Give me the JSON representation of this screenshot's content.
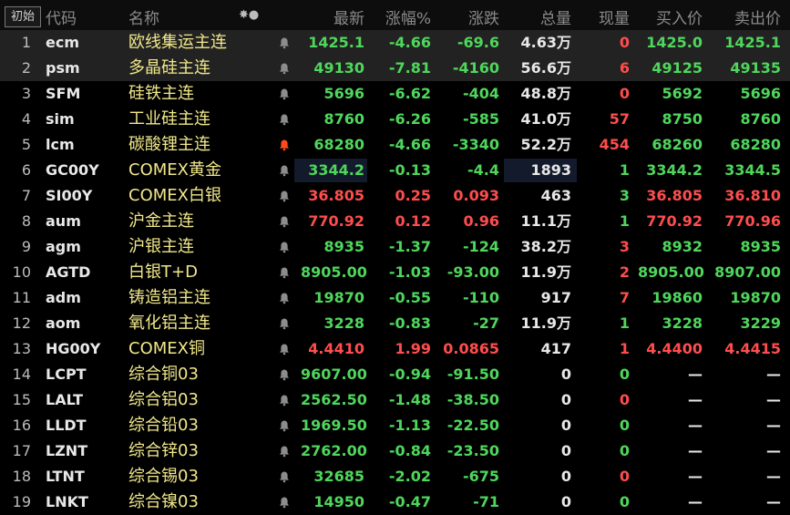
{
  "header": {
    "init_button": "初始",
    "columns": [
      "代码",
      "名称",
      "最新",
      "涨幅%",
      "涨跌",
      "总量",
      "现量",
      "买入价",
      "卖出价"
    ],
    "col_icons": "✸●"
  },
  "colors": {
    "up": "#ff4d4d",
    "down": "#4fd65c",
    "neutral": "#e8e8e8",
    "name": "#f0e78a"
  },
  "rows": [
    {
      "idx": "1",
      "code": "ecm",
      "name": "欧线集运主连",
      "last": "1425.1",
      "pct": "-4.66",
      "chg": "-69.6",
      "vol": "4.63万",
      "cur": "0",
      "bid": "1425.0",
      "ask": "1425.1",
      "alert": false
    },
    {
      "idx": "2",
      "code": "psm",
      "name": "多晶硅主连",
      "last": "49130",
      "pct": "-7.81",
      "chg": "-4160",
      "vol": "56.6万",
      "cur": "6",
      "bid": "49125",
      "ask": "49135",
      "alert": false
    },
    {
      "idx": "3",
      "code": "SFM",
      "name": "硅铁主连",
      "last": "5696",
      "pct": "-6.62",
      "chg": "-404",
      "vol": "48.8万",
      "cur": "0",
      "bid": "5692",
      "ask": "5696",
      "alert": false
    },
    {
      "idx": "4",
      "code": "sim",
      "name": "工业硅主连",
      "last": "8760",
      "pct": "-6.26",
      "chg": "-585",
      "vol": "41.0万",
      "cur": "57",
      "bid": "8750",
      "ask": "8760",
      "alert": false
    },
    {
      "idx": "5",
      "code": "lcm",
      "name": "碳酸锂主连",
      "last": "68280",
      "pct": "-4.66",
      "chg": "-3340",
      "vol": "52.2万",
      "cur": "454",
      "bid": "68260",
      "ask": "68280",
      "alert": true
    },
    {
      "idx": "6",
      "code": "GC00Y",
      "name": "COMEX黄金",
      "last": "3344.2",
      "pct": "-0.13",
      "chg": "-4.4",
      "vol": "1893",
      "cur": "1",
      "bid": "3344.2",
      "ask": "3344.5",
      "alert": false
    },
    {
      "idx": "7",
      "code": "SI00Y",
      "name": "COMEX白银",
      "last": "36.805",
      "pct": "0.25",
      "chg": "0.093",
      "vol": "463",
      "cur": "3",
      "bid": "36.805",
      "ask": "36.810",
      "alert": false
    },
    {
      "idx": "8",
      "code": "aum",
      "name": "沪金主连",
      "last": "770.92",
      "pct": "0.12",
      "chg": "0.96",
      "vol": "11.1万",
      "cur": "1",
      "bid": "770.92",
      "ask": "770.96",
      "alert": false
    },
    {
      "idx": "9",
      "code": "agm",
      "name": "沪银主连",
      "last": "8935",
      "pct": "-1.37",
      "chg": "-124",
      "vol": "38.2万",
      "cur": "3",
      "bid": "8932",
      "ask": "8935",
      "alert": false
    },
    {
      "idx": "10",
      "code": "AGTD",
      "name": "白银T+D",
      "last": "8905.00",
      "pct": "-1.03",
      "chg": "-93.00",
      "vol": "11.9万",
      "cur": "2",
      "bid": "8905.00",
      "ask": "8907.00",
      "alert": false
    },
    {
      "idx": "11",
      "code": "adm",
      "name": "铸造铝主连",
      "last": "19870",
      "pct": "-0.55",
      "chg": "-110",
      "vol": "917",
      "cur": "7",
      "bid": "19860",
      "ask": "19870",
      "alert": false
    },
    {
      "idx": "12",
      "code": "aom",
      "name": "氧化铝主连",
      "last": "3228",
      "pct": "-0.83",
      "chg": "-27",
      "vol": "11.9万",
      "cur": "1",
      "bid": "3228",
      "ask": "3229",
      "alert": false
    },
    {
      "idx": "13",
      "code": "HG00Y",
      "name": "COMEX铜",
      "last": "4.4410",
      "pct": "1.99",
      "chg": "0.0865",
      "vol": "417",
      "cur": "1",
      "bid": "4.4400",
      "ask": "4.4415",
      "alert": false
    },
    {
      "idx": "14",
      "code": "LCPT",
      "name": "综合铜03",
      "last": "9607.00",
      "pct": "-0.94",
      "chg": "-91.50",
      "vol": "0",
      "cur": "0",
      "bid": "—",
      "ask": "—",
      "alert": false
    },
    {
      "idx": "15",
      "code": "LALT",
      "name": "综合铝03",
      "last": "2562.50",
      "pct": "-1.48",
      "chg": "-38.50",
      "vol": "0",
      "cur": "0",
      "bid": "—",
      "ask": "—",
      "alert": false
    },
    {
      "idx": "16",
      "code": "LLDT",
      "name": "综合铅03",
      "last": "1969.50",
      "pct": "-1.13",
      "chg": "-22.50",
      "vol": "0",
      "cur": "0",
      "bid": "—",
      "ask": "—",
      "alert": false
    },
    {
      "idx": "17",
      "code": "LZNT",
      "name": "综合锌03",
      "last": "2762.00",
      "pct": "-0.84",
      "chg": "-23.50",
      "vol": "0",
      "cur": "0",
      "bid": "—",
      "ask": "—",
      "alert": false
    },
    {
      "idx": "18",
      "code": "LTNT",
      "name": "综合锡03",
      "last": "32685",
      "pct": "-2.02",
      "chg": "-675",
      "vol": "0",
      "cur": "0",
      "bid": "—",
      "ask": "—",
      "alert": false
    },
    {
      "idx": "19",
      "code": "LNKT",
      "name": "综合镍03",
      "last": "14950",
      "pct": "-0.47",
      "chg": "-71",
      "vol": "0",
      "cur": "0",
      "bid": "—",
      "ask": "—",
      "alert": false
    }
  ]
}
